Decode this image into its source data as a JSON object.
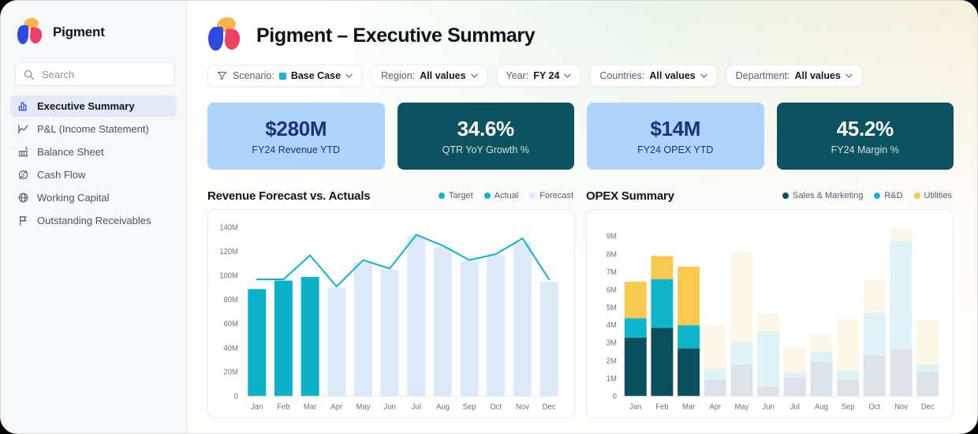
{
  "app": {
    "brand": "Pigment",
    "title": "Pigment – Executive Summary"
  },
  "sidebar": {
    "search_placeholder": "Search",
    "items": [
      {
        "label": "Executive Summary",
        "icon": "bar-chart",
        "active": true
      },
      {
        "label": "P&L (Income Statement)",
        "icon": "line-chart",
        "active": false
      },
      {
        "label": "Balance Sheet",
        "icon": "bank",
        "active": false
      },
      {
        "label": "Cash Flow",
        "icon": "cash-cycle",
        "active": false
      },
      {
        "label": "Working Capital",
        "icon": "globe",
        "active": false
      },
      {
        "label": "Outstanding Receivables",
        "icon": "flag",
        "active": false
      }
    ]
  },
  "filters": [
    {
      "id": "scenario",
      "label": "Scenario:",
      "value": "Base Case",
      "funnel_icon": true,
      "swatch_color": "#12b5c9"
    },
    {
      "id": "region",
      "label": "Region:",
      "value": "All values"
    },
    {
      "id": "year",
      "label": "Year:",
      "value": "FY 24"
    },
    {
      "id": "countries",
      "label": "Countries:",
      "value": "All values"
    },
    {
      "id": "department",
      "label": "Department:",
      "value": "All values"
    }
  ],
  "kpis": [
    {
      "value": "$280M",
      "label": "FY24 Revenue YTD",
      "variant": "light"
    },
    {
      "value": "34.6%",
      "label": "QTR YoY Growth %",
      "variant": "dark"
    },
    {
      "value": "$14M",
      "label": "FY24 OPEX YTD",
      "variant": "light"
    },
    {
      "value": "45.2%",
      "label": "FY24 Margin %",
      "variant": "dark"
    }
  ],
  "colors": {
    "petal_yellow": "#f8b54e",
    "petal_blue": "#2b49e3",
    "petal_pink": "#ef4166",
    "sidebar_active_bg": "#e3e9f7",
    "kpi_light_bg": "#afd3fa",
    "kpi_light_text": "#1e2f7d",
    "kpi_dark_bg": "#0c5260",
    "kpi_dark_text": "#ffffff",
    "accent_teal": "#0fb5c9"
  },
  "chart_data": [
    {
      "type": "bar+line",
      "title": "Revenue Forecast vs. Actuals",
      "categories": [
        "Jan",
        "Feb",
        "Mar",
        "Apr",
        "May",
        "Jun",
        "Jul",
        "Aug",
        "Sep",
        "Oct",
        "Nov",
        "Dec"
      ],
      "series": [
        {
          "name": "Target",
          "type": "line",
          "color": "#0fb5c9",
          "values": [
            97,
            97,
            117,
            91,
            113,
            106,
            134,
            125,
            113,
            118,
            131,
            97
          ]
        },
        {
          "name": "Actual",
          "type": "bar",
          "color": "#0ab1c8",
          "values": [
            89,
            96,
            99,
            null,
            null,
            null,
            null,
            null,
            null,
            null,
            null,
            null
          ]
        },
        {
          "name": "Forecast",
          "type": "bar",
          "color": "#dce9f9",
          "values": [
            null,
            null,
            null,
            90,
            111,
            105,
            133,
            124,
            112,
            117,
            128,
            95
          ]
        }
      ],
      "ylim": [
        0,
        140
      ],
      "yticks": [
        0,
        20,
        40,
        60,
        80,
        100,
        120,
        140
      ],
      "ytick_labels": [
        "0",
        "20M",
        "40M",
        "60M",
        "80M",
        "100M",
        "120M",
        "140M"
      ],
      "grid": false,
      "legend_position": "top-right",
      "unit": "M USD"
    },
    {
      "type": "stacked-bar",
      "title": "OPEX Summary",
      "categories": [
        "Jan",
        "Feb",
        "Mar",
        "Apr",
        "May",
        "Jun",
        "Jul",
        "Aug",
        "Sep",
        "Oct",
        "Nov",
        "Dec"
      ],
      "series": [
        {
          "name": "Sales & Marketing",
          "color": "#0b4f5e",
          "faded_color": "#dce3e8",
          "values": [
            3.3,
            3.85,
            2.7,
            0.9,
            1.8,
            0.55,
            1.05,
            1.95,
            0.9,
            2.3,
            2.65,
            1.35
          ]
        },
        {
          "name": "R&D",
          "color": "#0fb5c9",
          "faded_color": "#dff2f6",
          "values": [
            1.1,
            2.75,
            1.3,
            0.65,
            1.25,
            3.1,
            0.3,
            0.55,
            0.55,
            2.4,
            6.1,
            0.45
          ]
        },
        {
          "name": "Utilities",
          "color": "#f9c84e",
          "faded_color": "#fdf7e8",
          "values": [
            2.05,
            1.3,
            3.3,
            2.45,
            5.1,
            1.0,
            1.4,
            0.95,
            2.9,
            1.85,
            0.7,
            2.5
          ]
        }
      ],
      "faded_from_index": 3,
      "ylim": [
        0,
        9.5
      ],
      "yticks": [
        0,
        1,
        2,
        3,
        4,
        5,
        6,
        7,
        8,
        9
      ],
      "ytick_labels": [
        "0",
        "1M",
        "2M",
        "3M",
        "4M",
        "5M",
        "6M",
        "7M",
        "8M",
        "9M"
      ],
      "grid": false,
      "legend_position": "top-right",
      "unit": "M USD"
    }
  ]
}
